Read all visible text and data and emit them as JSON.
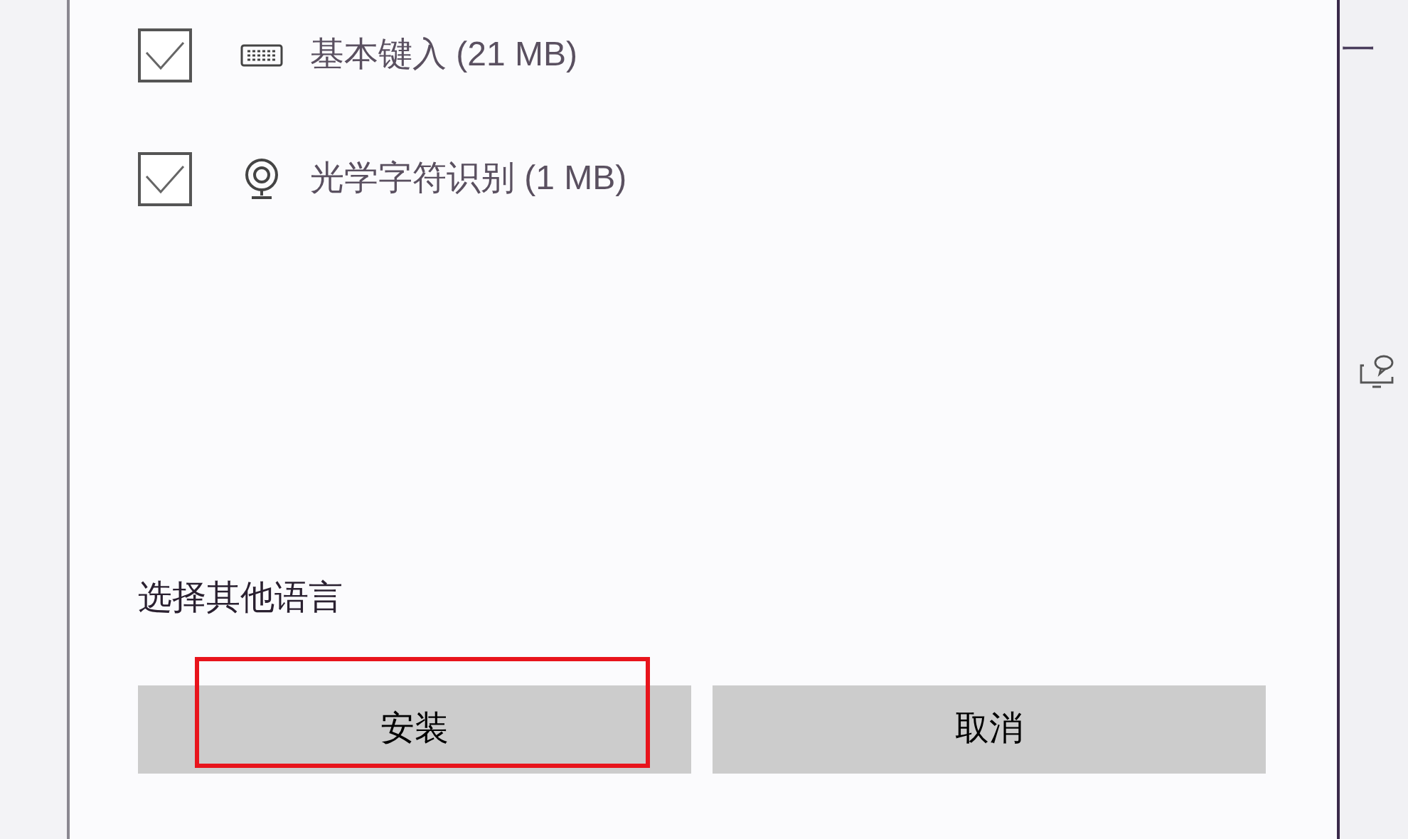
{
  "features": [
    {
      "label": "基本键入 (21 MB)",
      "checked": true,
      "kind": "keyboard"
    },
    {
      "label": "光学字符识别 (1 MB)",
      "checked": true,
      "kind": "camera"
    }
  ],
  "link": "选择其他语言",
  "buttons": [
    {
      "label": "安装",
      "highlighted": true
    },
    {
      "label": "取消",
      "highlighted": false
    }
  ],
  "background": {
    "text": "一"
  }
}
